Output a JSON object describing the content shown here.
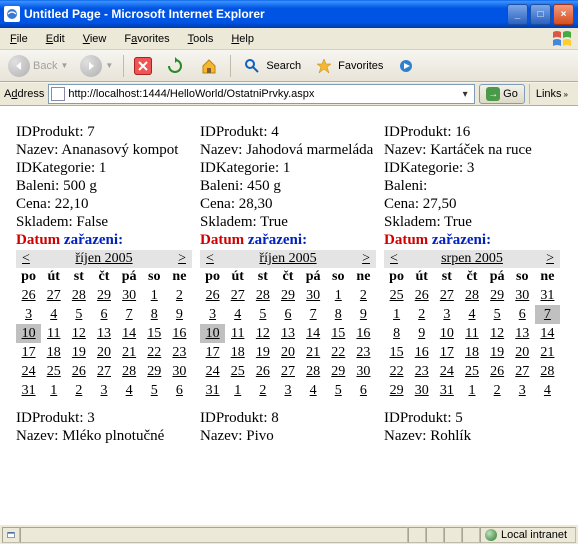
{
  "window": {
    "title": "Untitled Page - Microsoft Internet Explorer"
  },
  "menu": {
    "file": "File",
    "edit": "Edit",
    "view": "View",
    "favorites": "Favorites",
    "tools": "Tools",
    "help": "Help"
  },
  "toolbar": {
    "back": "Back",
    "search": "Search",
    "favorites": "Favorites"
  },
  "address": {
    "label": "Address",
    "url": "http://localhost:1444/HelloWorld/OstatniPrvky.aspx",
    "go": "Go",
    "links": "Links"
  },
  "labels": {
    "id": "IDProdukt:",
    "nazev": "Nazev:",
    "kat": "IDKategorie:",
    "baleni": "Baleni:",
    "cena": "Cena:",
    "skladem": "Skladem:",
    "datum_red": "Datum",
    "datum_blue": " zařazeni:"
  },
  "days": [
    "po",
    "út",
    "st",
    "čt",
    "pá",
    "so",
    "ne"
  ],
  "products": [
    {
      "id": "7",
      "nazev": "Ananasový kompot",
      "kat": "1",
      "baleni": "500 g",
      "cena": "22,10",
      "skladem": "False",
      "cal": {
        "title": "říjen 2005",
        "selected": "10",
        "rows": [
          [
            "26",
            "27",
            "28",
            "29",
            "30",
            "1",
            "2"
          ],
          [
            "3",
            "4",
            "5",
            "6",
            "7",
            "8",
            "9"
          ],
          [
            "10",
            "11",
            "12",
            "13",
            "14",
            "15",
            "16"
          ],
          [
            "17",
            "18",
            "19",
            "20",
            "21",
            "22",
            "23"
          ],
          [
            "24",
            "25",
            "26",
            "27",
            "28",
            "29",
            "30"
          ],
          [
            "31",
            "1",
            "2",
            "3",
            "4",
            "5",
            "6"
          ]
        ]
      }
    },
    {
      "id": "4",
      "nazev": "Jahodová marmeláda",
      "kat": "1",
      "baleni": "450 g",
      "cena": "28,30",
      "skladem": "True",
      "cal": {
        "title": "říjen 2005",
        "selected": "10",
        "rows": [
          [
            "26",
            "27",
            "28",
            "29",
            "30",
            "1",
            "2"
          ],
          [
            "3",
            "4",
            "5",
            "6",
            "7",
            "8",
            "9"
          ],
          [
            "10",
            "11",
            "12",
            "13",
            "14",
            "15",
            "16"
          ],
          [
            "17",
            "18",
            "19",
            "20",
            "21",
            "22",
            "23"
          ],
          [
            "24",
            "25",
            "26",
            "27",
            "28",
            "29",
            "30"
          ],
          [
            "31",
            "1",
            "2",
            "3",
            "4",
            "5",
            "6"
          ]
        ]
      }
    },
    {
      "id": "16",
      "nazev": "Kartáček na ruce",
      "kat": "3",
      "baleni": "",
      "cena": "27,50",
      "skladem": "True",
      "cal": {
        "title": "srpen 2005",
        "selected": "7",
        "rows": [
          [
            "25",
            "26",
            "27",
            "28",
            "29",
            "30",
            "31"
          ],
          [
            "1",
            "2",
            "3",
            "4",
            "5",
            "6",
            "7"
          ],
          [
            "8",
            "9",
            "10",
            "11",
            "12",
            "13",
            "14"
          ],
          [
            "15",
            "16",
            "17",
            "18",
            "19",
            "20",
            "21"
          ],
          [
            "22",
            "23",
            "24",
            "25",
            "26",
            "27",
            "28"
          ],
          [
            "29",
            "30",
            "31",
            "1",
            "2",
            "3",
            "4"
          ]
        ]
      }
    },
    {
      "id": "3",
      "nazev": "Mléko plnotučné"
    },
    {
      "id": "8",
      "nazev": "Pivo"
    },
    {
      "id": "5",
      "nazev": "Rohlík"
    }
  ],
  "status": {
    "zone": "Local intranet"
  }
}
